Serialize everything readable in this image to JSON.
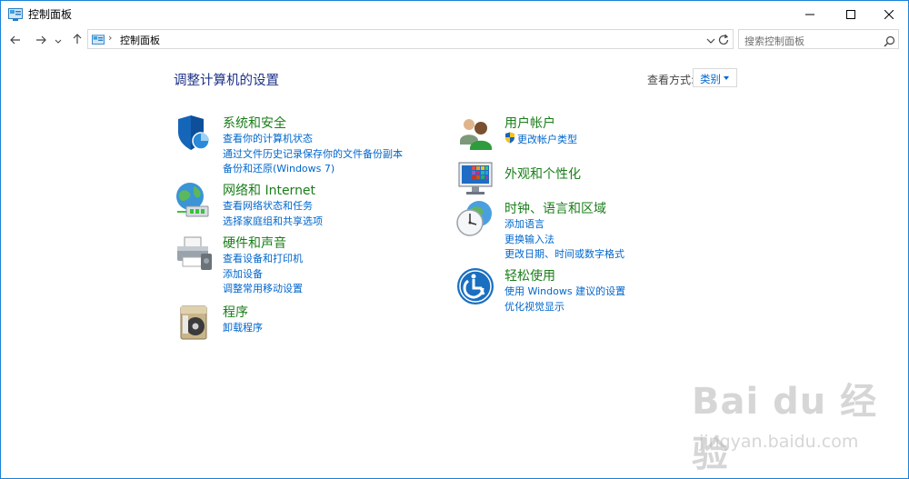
{
  "window": {
    "title": "控制面板"
  },
  "nav": {
    "breadcrumb_separator": "›",
    "address_text": "控制面板",
    "search_placeholder": "搜索控制面板"
  },
  "main": {
    "page_title": "调整计算机的设置",
    "view_label": "查看方式:",
    "view_value": "类别"
  },
  "categories_left": [
    {
      "title": "系统和安全",
      "icon": "security-shield-icon",
      "links": [
        "查看你的计算机状态",
        "通过文件历史记录保存你的文件备份副本",
        "备份和还原(Windows 7)"
      ]
    },
    {
      "title": "网络和 Internet",
      "icon": "network-globe-icon",
      "links": [
        "查看网络状态和任务",
        "选择家庭组和共享选项"
      ]
    },
    {
      "title": "硬件和声音",
      "icon": "printer-icon",
      "links": [
        "查看设备和打印机",
        "添加设备",
        "调整常用移动设置"
      ]
    },
    {
      "title": "程序",
      "icon": "programs-icon",
      "links": [
        "卸载程序"
      ]
    }
  ],
  "categories_right": [
    {
      "title": "用户帐户",
      "icon": "user-accounts-icon",
      "links": [
        "更改帐户类型"
      ]
    },
    {
      "title": "外观和个性化",
      "icon": "appearance-monitor-icon",
      "links": []
    },
    {
      "title": "时钟、语言和区域",
      "icon": "clock-globe-icon",
      "links": [
        "添加语言",
        "更换输入法",
        "更改日期、时间或数字格式"
      ]
    },
    {
      "title": "轻松使用",
      "icon": "ease-of-access-icon",
      "links": [
        "使用 Windows 建议的设置",
        "优化视觉显示"
      ]
    }
  ],
  "watermark": {
    "logo": "Bai du 经验",
    "url": "jingyan.baidu.com"
  },
  "colors": {
    "link": "#0066cc",
    "category_title": "#1a7e1a",
    "page_title": "#1e3287",
    "window_border": "#1883d7"
  }
}
